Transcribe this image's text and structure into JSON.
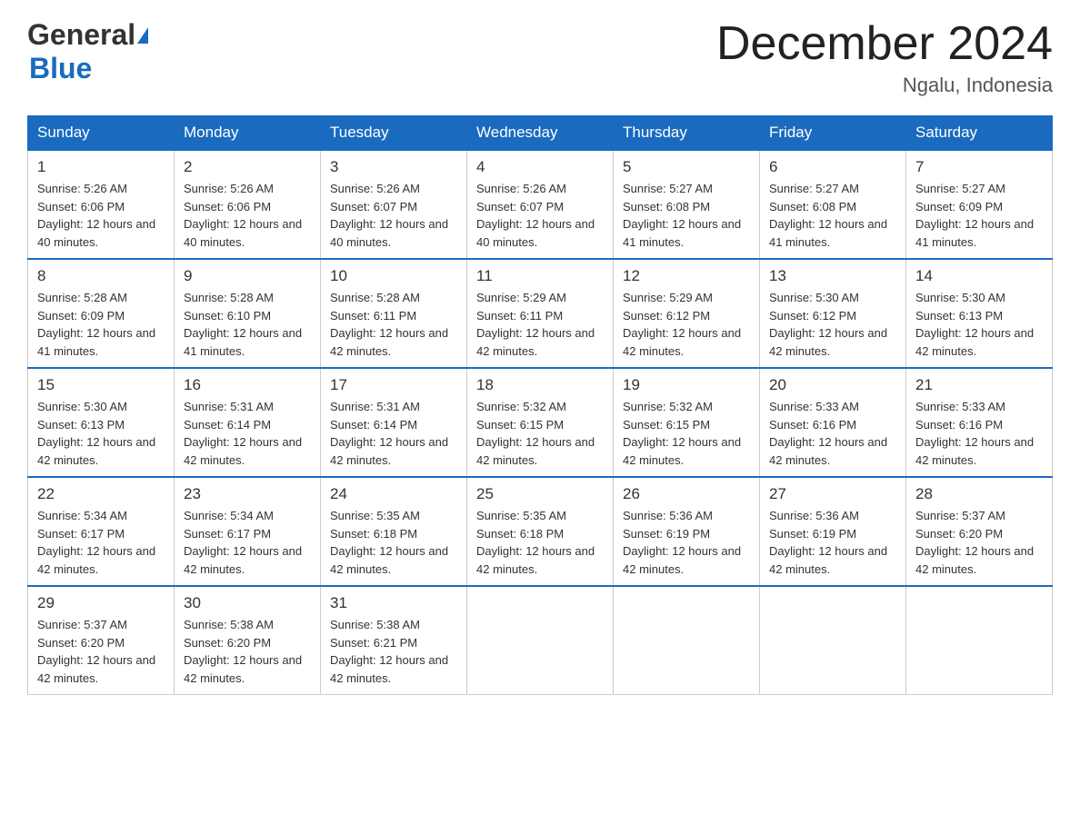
{
  "header": {
    "logo_general": "General",
    "logo_blue": "Blue",
    "month_title": "December 2024",
    "location": "Ngalu, Indonesia"
  },
  "days_of_week": [
    "Sunday",
    "Monday",
    "Tuesday",
    "Wednesday",
    "Thursday",
    "Friday",
    "Saturday"
  ],
  "weeks": [
    [
      {
        "day": 1,
        "sunrise": "5:26 AM",
        "sunset": "6:06 PM",
        "daylight": "12 hours and 40 minutes."
      },
      {
        "day": 2,
        "sunrise": "5:26 AM",
        "sunset": "6:06 PM",
        "daylight": "12 hours and 40 minutes."
      },
      {
        "day": 3,
        "sunrise": "5:26 AM",
        "sunset": "6:07 PM",
        "daylight": "12 hours and 40 minutes."
      },
      {
        "day": 4,
        "sunrise": "5:26 AM",
        "sunset": "6:07 PM",
        "daylight": "12 hours and 40 minutes."
      },
      {
        "day": 5,
        "sunrise": "5:27 AM",
        "sunset": "6:08 PM",
        "daylight": "12 hours and 41 minutes."
      },
      {
        "day": 6,
        "sunrise": "5:27 AM",
        "sunset": "6:08 PM",
        "daylight": "12 hours and 41 minutes."
      },
      {
        "day": 7,
        "sunrise": "5:27 AM",
        "sunset": "6:09 PM",
        "daylight": "12 hours and 41 minutes."
      }
    ],
    [
      {
        "day": 8,
        "sunrise": "5:28 AM",
        "sunset": "6:09 PM",
        "daylight": "12 hours and 41 minutes."
      },
      {
        "day": 9,
        "sunrise": "5:28 AM",
        "sunset": "6:10 PM",
        "daylight": "12 hours and 41 minutes."
      },
      {
        "day": 10,
        "sunrise": "5:28 AM",
        "sunset": "6:11 PM",
        "daylight": "12 hours and 42 minutes."
      },
      {
        "day": 11,
        "sunrise": "5:29 AM",
        "sunset": "6:11 PM",
        "daylight": "12 hours and 42 minutes."
      },
      {
        "day": 12,
        "sunrise": "5:29 AM",
        "sunset": "6:12 PM",
        "daylight": "12 hours and 42 minutes."
      },
      {
        "day": 13,
        "sunrise": "5:30 AM",
        "sunset": "6:12 PM",
        "daylight": "12 hours and 42 minutes."
      },
      {
        "day": 14,
        "sunrise": "5:30 AM",
        "sunset": "6:13 PM",
        "daylight": "12 hours and 42 minutes."
      }
    ],
    [
      {
        "day": 15,
        "sunrise": "5:30 AM",
        "sunset": "6:13 PM",
        "daylight": "12 hours and 42 minutes."
      },
      {
        "day": 16,
        "sunrise": "5:31 AM",
        "sunset": "6:14 PM",
        "daylight": "12 hours and 42 minutes."
      },
      {
        "day": 17,
        "sunrise": "5:31 AM",
        "sunset": "6:14 PM",
        "daylight": "12 hours and 42 minutes."
      },
      {
        "day": 18,
        "sunrise": "5:32 AM",
        "sunset": "6:15 PM",
        "daylight": "12 hours and 42 minutes."
      },
      {
        "day": 19,
        "sunrise": "5:32 AM",
        "sunset": "6:15 PM",
        "daylight": "12 hours and 42 minutes."
      },
      {
        "day": 20,
        "sunrise": "5:33 AM",
        "sunset": "6:16 PM",
        "daylight": "12 hours and 42 minutes."
      },
      {
        "day": 21,
        "sunrise": "5:33 AM",
        "sunset": "6:16 PM",
        "daylight": "12 hours and 42 minutes."
      }
    ],
    [
      {
        "day": 22,
        "sunrise": "5:34 AM",
        "sunset": "6:17 PM",
        "daylight": "12 hours and 42 minutes."
      },
      {
        "day": 23,
        "sunrise": "5:34 AM",
        "sunset": "6:17 PM",
        "daylight": "12 hours and 42 minutes."
      },
      {
        "day": 24,
        "sunrise": "5:35 AM",
        "sunset": "6:18 PM",
        "daylight": "12 hours and 42 minutes."
      },
      {
        "day": 25,
        "sunrise": "5:35 AM",
        "sunset": "6:18 PM",
        "daylight": "12 hours and 42 minutes."
      },
      {
        "day": 26,
        "sunrise": "5:36 AM",
        "sunset": "6:19 PM",
        "daylight": "12 hours and 42 minutes."
      },
      {
        "day": 27,
        "sunrise": "5:36 AM",
        "sunset": "6:19 PM",
        "daylight": "12 hours and 42 minutes."
      },
      {
        "day": 28,
        "sunrise": "5:37 AM",
        "sunset": "6:20 PM",
        "daylight": "12 hours and 42 minutes."
      }
    ],
    [
      {
        "day": 29,
        "sunrise": "5:37 AM",
        "sunset": "6:20 PM",
        "daylight": "12 hours and 42 minutes."
      },
      {
        "day": 30,
        "sunrise": "5:38 AM",
        "sunset": "6:20 PM",
        "daylight": "12 hours and 42 minutes."
      },
      {
        "day": 31,
        "sunrise": "5:38 AM",
        "sunset": "6:21 PM",
        "daylight": "12 hours and 42 minutes."
      },
      null,
      null,
      null,
      null
    ]
  ]
}
